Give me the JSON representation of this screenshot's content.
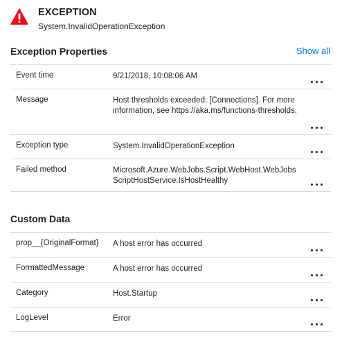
{
  "header": {
    "title": "EXCEPTION",
    "subtitle": "System.InvalidOperationException",
    "icon": "warning-icon",
    "icon_color": "#e81123"
  },
  "exception_properties": {
    "title": "Exception Properties",
    "show_all": "Show all",
    "rows": [
      {
        "label": "Event time",
        "value": "9/21/2018, 10:08:06 AM"
      },
      {
        "label": "Message",
        "value": "Host thresholds exceeded: [Connections]. For more information, see https://aka.ms/functions-thresholds."
      },
      {
        "label": "Exception type",
        "value": "System.InvalidOperationException"
      },
      {
        "label": "Failed method",
        "value": "Microsoft.Azure.WebJobs.Script.WebHost.WebJobsScriptHostService.IsHostHealthy"
      }
    ]
  },
  "custom_data": {
    "title": "Custom Data",
    "rows": [
      {
        "label": "prop__{OriginalFormat}",
        "value": "A host error has occurred"
      },
      {
        "label": "FormattedMessage",
        "value": "A host error has occurred"
      },
      {
        "label": "Category",
        "value": "Host.Startup"
      },
      {
        "label": "LogLevel",
        "value": "Error"
      }
    ]
  },
  "colors": {
    "accent": "#0078d4",
    "error": "#e81123",
    "divider": "#d9d9d9"
  }
}
